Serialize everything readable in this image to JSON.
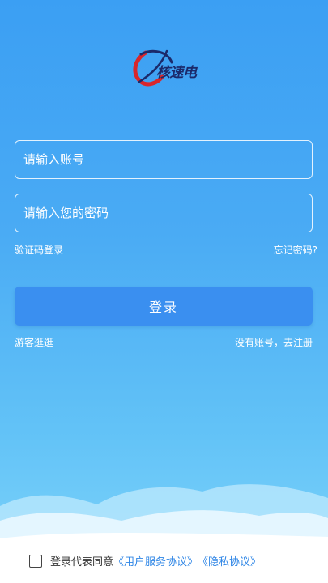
{
  "logo": {
    "text": "核速电"
  },
  "form": {
    "account_placeholder": "请输入账号",
    "password_placeholder": "请输入您的密码",
    "sms_login": "验证码登录",
    "forgot_password": "忘记密码?",
    "login_button": "登录",
    "guest_browse": "游客逛逛",
    "register": "没有账号，去注册"
  },
  "agreement": {
    "prefix": "登录代表同意",
    "user_agreement": "《用户服务协议》",
    "privacy_policy": "《隐私协议》",
    "checked": false
  },
  "colors": {
    "background_top": "#3b9ff3",
    "background_bottom": "#7fd4fa",
    "button": "#3a8ff0",
    "link_blue": "#2f86e6"
  }
}
